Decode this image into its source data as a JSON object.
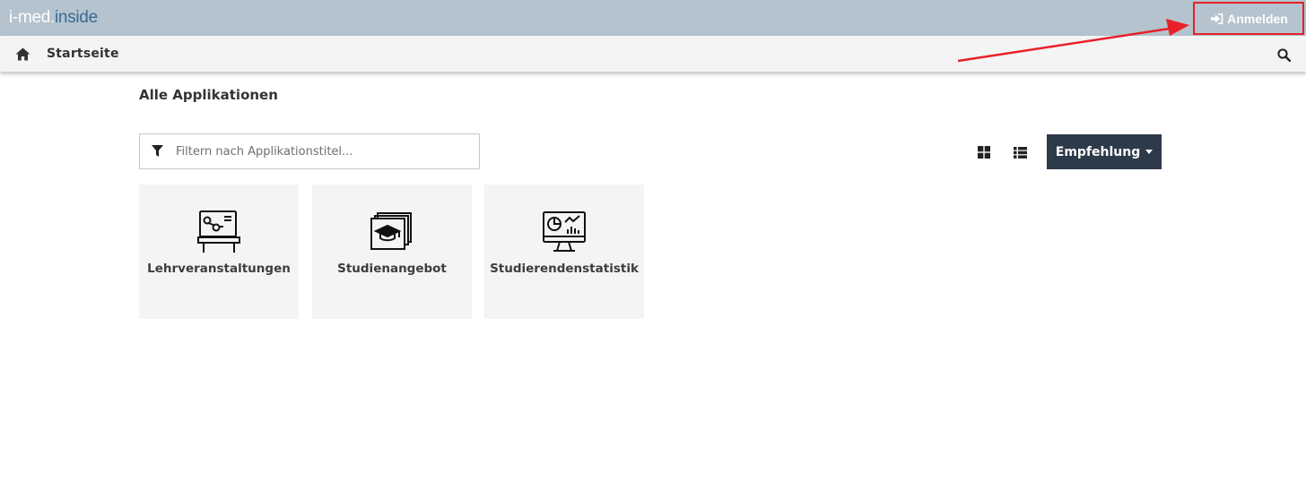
{
  "app": {
    "logo_part1": "i-med.",
    "logo_part2": "inside"
  },
  "header": {
    "login_label": "Anmelden"
  },
  "nav": {
    "home_label": "Startseite"
  },
  "main": {
    "title": "Alle Applikationen",
    "filter_placeholder": "Filtern nach Applikationstitel...",
    "sort_label": "Empfehlung",
    "tiles": [
      {
        "label": "Lehrveranstaltungen",
        "icon": "lecture-board-icon"
      },
      {
        "label": "Studienangebot",
        "icon": "graduation-cap-icon"
      },
      {
        "label": "Studierendenstatistik",
        "icon": "statistics-monitor-icon"
      }
    ]
  },
  "colors": {
    "topbar": "#b4c3cd",
    "sort_button": "#2d3a4a",
    "annotation": "#e8202a"
  }
}
